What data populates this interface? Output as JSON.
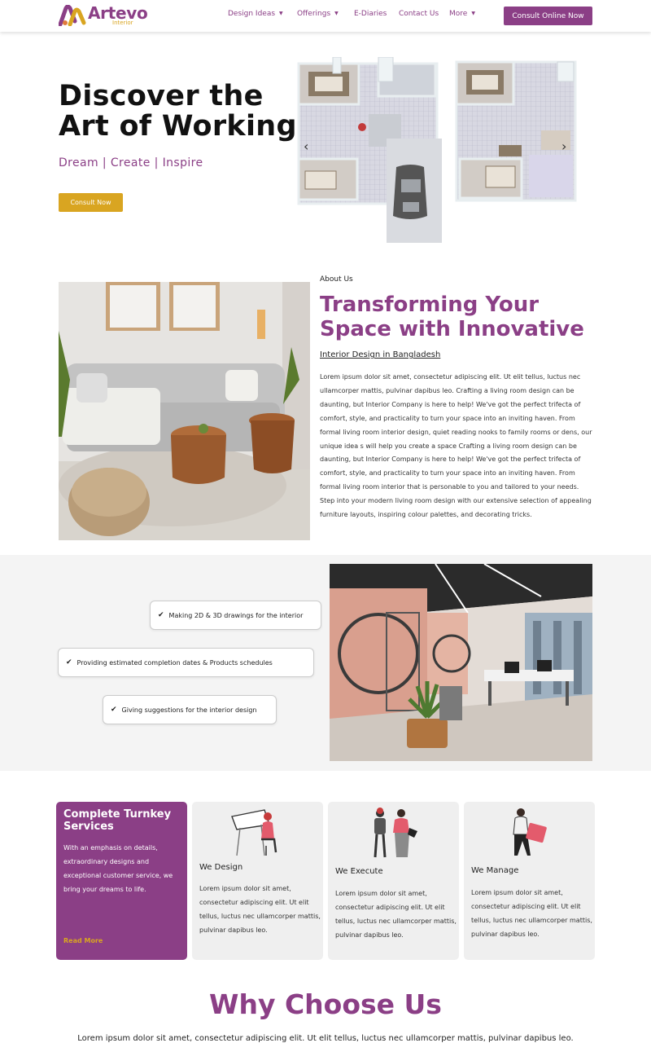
{
  "brand": {
    "name": "Artevo",
    "tagline": "Interior",
    "accent": "#8b3f86",
    "gold": "#d9a521"
  },
  "nav": {
    "items": [
      {
        "label": "Design Ideas",
        "dropdown": true
      },
      {
        "label": "Offerings",
        "dropdown": true
      },
      {
        "label": "E-Diaries",
        "dropdown": false
      },
      {
        "label": "Contact Us",
        "dropdown": false
      },
      {
        "label": "More",
        "dropdown": true
      }
    ],
    "cta": "Consult Online Now"
  },
  "hero": {
    "title_line1": "Discover the",
    "title_line2": "Art of Working",
    "subtitle": "Dream | Create | Inspire",
    "button": "Consult Now",
    "prev_icon": "chevron-left-icon",
    "next_icon": "chevron-right-icon"
  },
  "about": {
    "kicker": "About Us",
    "heading": "Transforming Your Space with Innovative",
    "subheading": "Interior Design in Bangladesh",
    "body": "Lorem ipsum dolor sit amet, consectetur adipiscing elit. Ut elit tellus, luctus nec ullamcorper mattis, pulvinar dapibus leo. Crafting a living room design can be daunting, but Interior Company is here to help! We've got the perfect trifecta of comfort, style, and practicality to turn your space into an inviting haven. From formal living room interior design, quiet reading nooks to family rooms or dens, our unique idea s will help you create a space Crafting a living room design can be daunting, but Interior Company is here to help! We've got the perfect trifecta of comfort, style, and practicality to turn your space into an inviting haven. From formal living room interior that is personable to you and tailored to your needs. Step into your modern living room design with our extensive selection of appealing furniture layouts, inspiring colour palettes, and decorating tricks."
  },
  "features": {
    "items": [
      "Making 2D & 3D drawings for the interior",
      "Providing estimated completion dates & Products schedules",
      "Giving suggestions for the interior design"
    ]
  },
  "services": {
    "intro": {
      "title": "Complete Turnkey Services",
      "text": "With an emphasis on details, extraordinary designs and exceptional customer service, we bring your dreams to life.",
      "link": "Read More"
    },
    "cards": [
      {
        "title": "We Design",
        "text": "Lorem ipsum dolor sit amet, consectetur adipiscing elit. Ut elit tellus, luctus nec ullamcorper mattis, pulvinar dapibus leo.",
        "icon": "designer-drafting-icon"
      },
      {
        "title": "We Execute",
        "text": "Lorem ipsum dolor sit amet, consectetur adipiscing elit. Ut elit tellus, luctus nec ullamcorper mattis, pulvinar dapibus leo.",
        "icon": "team-meeting-icon"
      },
      {
        "title": "We Manage",
        "text": "Lorem ipsum dolor sit amet, consectetur adipiscing elit. Ut elit tellus, luctus nec ullamcorper mattis, pulvinar dapibus leo.",
        "icon": "manager-folder-icon"
      }
    ]
  },
  "why": {
    "heading": "Why Choose Us",
    "text": "Lorem ipsum dolor sit amet, consectetur adipiscing elit. Ut elit tellus, luctus nec ullamcorper mattis, pulvinar dapibus leo."
  }
}
